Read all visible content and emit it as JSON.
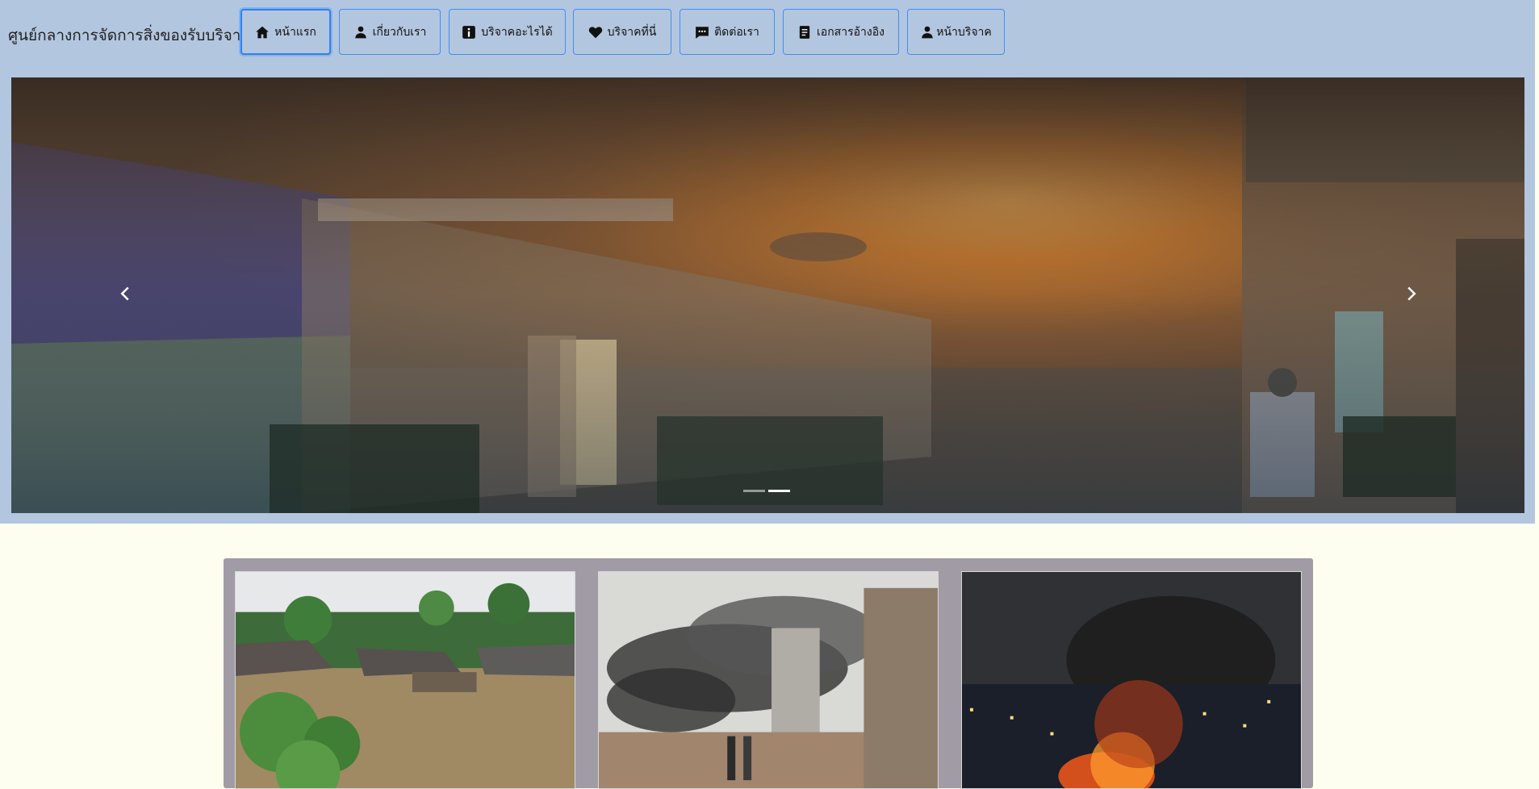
{
  "header": {
    "brand": "ศูนย์กลางการจัดการสิ่งของรับบริจาค",
    "nav": [
      {
        "label": "หน้าแรก",
        "icon": "home-icon"
      },
      {
        "label": "เกี่ยวกับเรา",
        "icon": "person-icon"
      },
      {
        "label": "บริจาคอะไรได้",
        "icon": "info-icon"
      },
      {
        "label": "บริจาคที่นี่",
        "icon": "heart-icon"
      },
      {
        "label": "ติดต่อเรา",
        "icon": "chat-icon"
      },
      {
        "label": "เอกสารอ้างอิง",
        "icon": "document-icon"
      },
      {
        "label": "หน้าบริจาค",
        "icon": "person-icon"
      }
    ],
    "active_index": 0
  },
  "carousel": {
    "slide_image": "smoke-fire-street-photo",
    "prev_icon": "chevron-left-icon",
    "next_icon": "chevron-right-icon",
    "indicator_count": 2,
    "active_indicator": 1
  },
  "gallery": {
    "cards": [
      {
        "image": "flooded-village-photo"
      },
      {
        "image": "explosion-aftermath-photo"
      },
      {
        "image": "city-fire-night-photo"
      }
    ]
  },
  "colors": {
    "header_bg": "#b3c6df",
    "page_bg": "#fdfeef",
    "button_border": "#3f8ff2",
    "gallery_bg": "#a09ba4"
  }
}
